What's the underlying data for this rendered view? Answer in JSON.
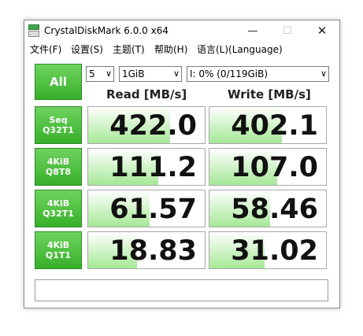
{
  "window": {
    "title": "CrystalDiskMark 6.0.0 x64",
    "minimize_glyph": "—",
    "maximize_glyph": "☐",
    "close_glyph": "✕"
  },
  "menu": [
    "文件(F)",
    "设置(S)",
    "主题(T)",
    "帮助(H)",
    "语言(L)(Language)"
  ],
  "controls": {
    "all_label": "All",
    "count": "5",
    "size": "1GiB",
    "drive": "I: 0% (0/119GiB)"
  },
  "headers": {
    "read": "Read [MB/s]",
    "write": "Write [MB/s]"
  },
  "rows": [
    {
      "label1": "Seq",
      "label2": "Q32T1",
      "read": "422.0",
      "write": "402.1",
      "read_fill": 0.7,
      "write_fill": 0.62
    },
    {
      "label1": "4KiB",
      "label2": "Q8T8",
      "read": "111.2",
      "write": "107.0",
      "read_fill": 0.6,
      "write_fill": 0.58
    },
    {
      "label1": "4KiB",
      "label2": "Q32T1",
      "read": "61.57",
      "write": "58.46",
      "read_fill": 0.53,
      "write_fill": 0.52
    },
    {
      "label1": "4KiB",
      "label2": "Q1T1",
      "read": "18.83",
      "write": "31.02",
      "read_fill": 0.42,
      "write_fill": 0.47
    }
  ],
  "status": "",
  "colors": {
    "accent_green": "#37b02a",
    "fill_green": "#a5e896"
  }
}
